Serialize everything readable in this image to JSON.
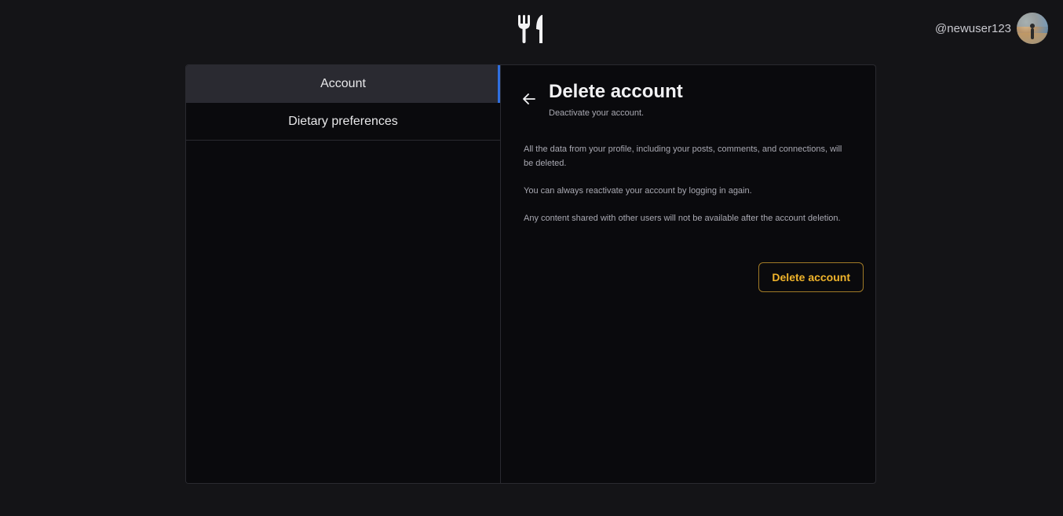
{
  "header": {
    "logo_icon": "fork-knife-icon",
    "username": "@newuser123",
    "avatar_icon": "user-avatar"
  },
  "sidebar": {
    "items": [
      {
        "label": "Account",
        "active": true
      },
      {
        "label": "Dietary preferences",
        "active": false
      }
    ],
    "active_color": "#2f6fe0"
  },
  "main": {
    "back_icon": "arrow-left-icon",
    "title": "Delete account",
    "subtitle": "Deactivate your account.",
    "paragraphs": [
      "All the data from your profile, including your posts, comments, and connections, will be deleted.",
      "You can always reactivate your account by logging in again.",
      "Any content shared with other users will not be available after the account deletion."
    ],
    "delete_button_label": "Delete account",
    "delete_button_color": "#f0b42b"
  }
}
